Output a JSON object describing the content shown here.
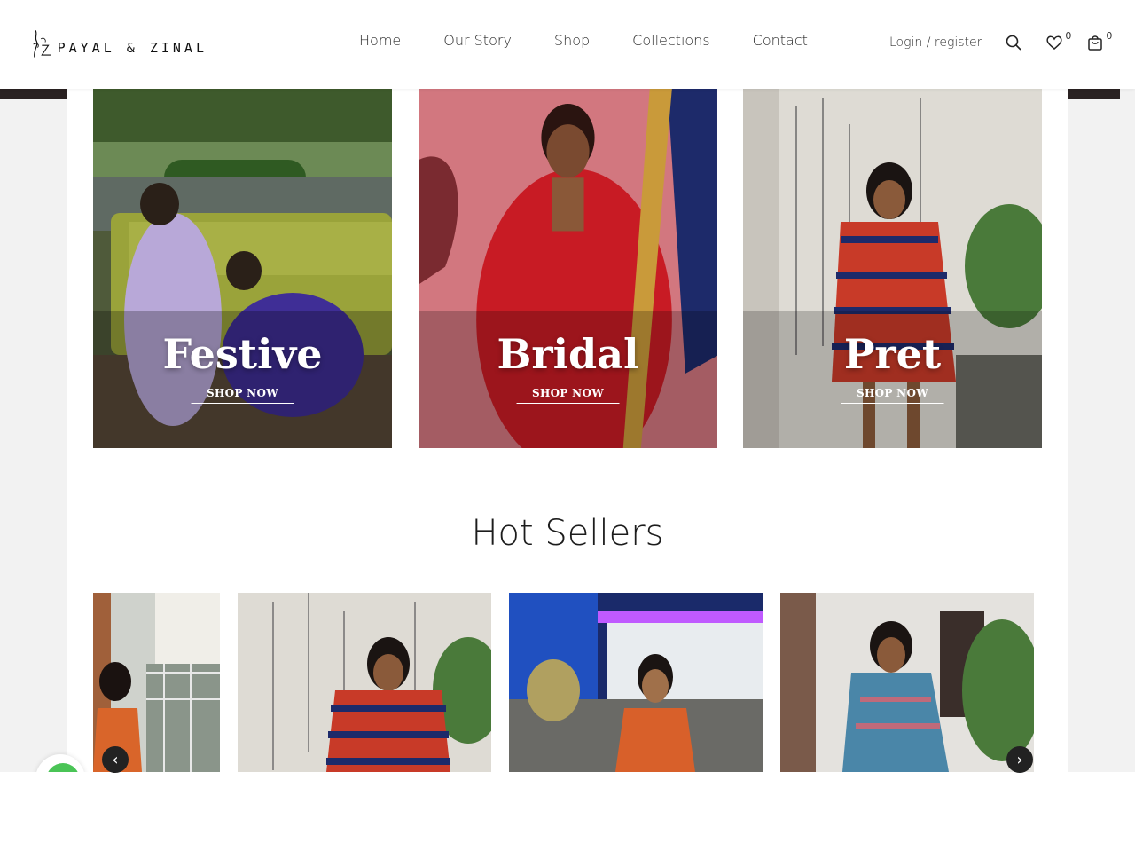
{
  "brand": {
    "name": "PAYAL & ZINAL"
  },
  "nav": [
    "Home",
    "Our Story",
    "Shop",
    "Collections",
    "Contact"
  ],
  "header": {
    "login_label": "Login / register",
    "wishlist_count": "0",
    "cart_count": "0",
    "icons": [
      "search-icon",
      "heart-icon",
      "bag-icon"
    ]
  },
  "categories": [
    {
      "title": "Festive",
      "cta": "SHOP NOW"
    },
    {
      "title": "Bridal",
      "cta": "SHOP NOW"
    },
    {
      "title": "Pret",
      "cta": "SHOP NOW"
    }
  ],
  "hot_sellers": {
    "title": "Hot Sellers",
    "prev_label": "‹",
    "next_label": "›"
  },
  "colors": {
    "accent_dark": "#222222",
    "chat_green": "#4ac456",
    "text": "#1c1c1c"
  }
}
